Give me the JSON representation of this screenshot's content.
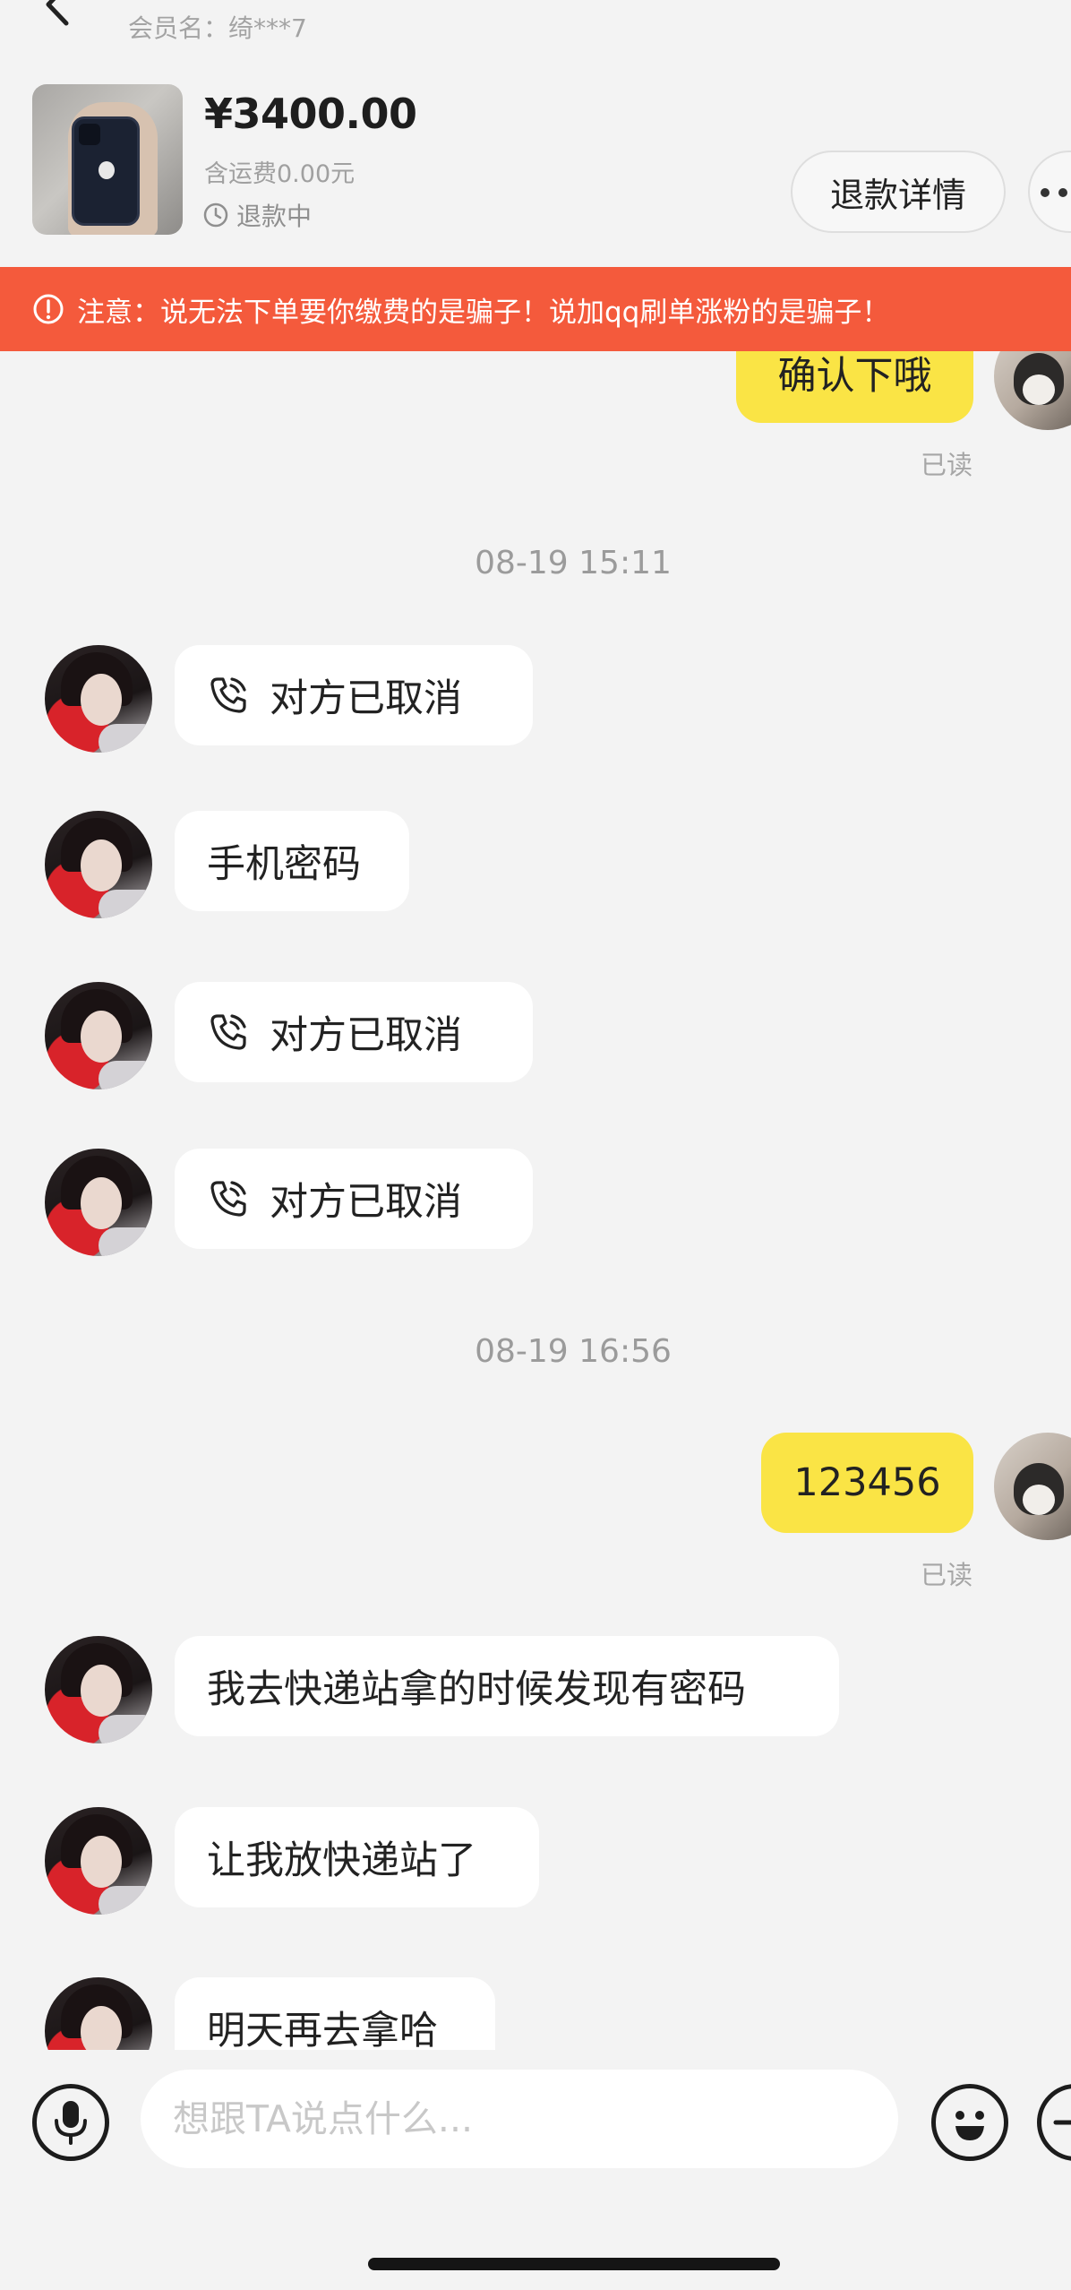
{
  "header": {
    "member_label": "会员名：绮***7",
    "price": "¥3400.00",
    "shipping": "含运费0.00元",
    "status": "退款中",
    "refund_button": "退款详情"
  },
  "warning": {
    "text": "注意：说无法下单要你缴费的是骗子！说加qq刷单涨粉的是骗子！",
    "color": "#f45a3c"
  },
  "colors": {
    "self_bubble": "#fae445",
    "other_bubble": "#ffffff",
    "background": "#f3f3f3"
  },
  "messages": [
    {
      "from": "self",
      "text": "确认下哦",
      "read": "已读"
    },
    {
      "type": "time",
      "text": "08-19 15:11"
    },
    {
      "from": "other",
      "type": "call",
      "icon": "phone-call-icon",
      "text": "对方已取消"
    },
    {
      "from": "other",
      "text": "手机密码"
    },
    {
      "from": "other",
      "type": "call",
      "icon": "phone-call-icon",
      "text": "对方已取消"
    },
    {
      "from": "other",
      "type": "call",
      "icon": "phone-call-icon",
      "text": "对方已取消"
    },
    {
      "type": "time",
      "text": "08-19 16:56"
    },
    {
      "from": "self",
      "text": "123456",
      "read": "已读"
    },
    {
      "from": "other",
      "text": "我去快递站拿的时候发现有密码"
    },
    {
      "from": "other",
      "text": "让我放快递站了"
    },
    {
      "from": "other",
      "text": "明天再去拿哈"
    }
  ],
  "input": {
    "placeholder": "想跟TA说点什么..."
  }
}
